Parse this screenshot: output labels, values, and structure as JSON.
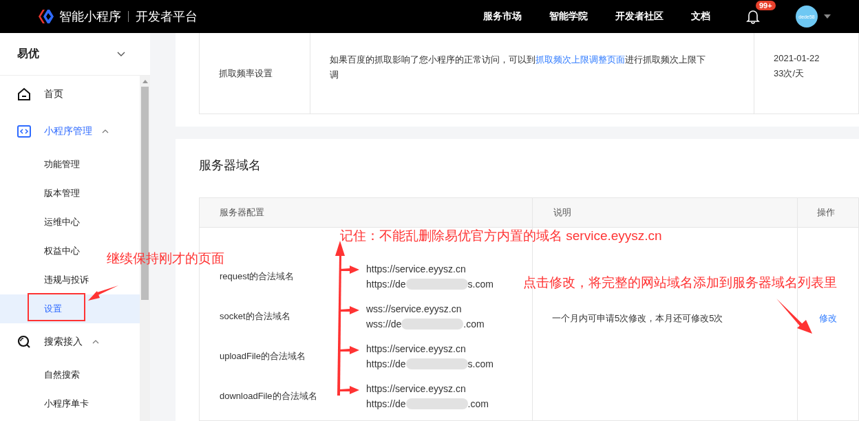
{
  "topbar": {
    "brand": "智能小程序",
    "subtitle": "开发者平台",
    "nav": [
      "服务市场",
      "智能学院",
      "开发者社区",
      "文档"
    ],
    "badge": "99+",
    "avatar": "dede58"
  },
  "sidebar": {
    "app": "易优",
    "items": [
      {
        "label": "首页",
        "active": false
      },
      {
        "label": "小程序管理",
        "active": true,
        "expanded": true,
        "children": [
          {
            "label": "功能管理",
            "selected": false
          },
          {
            "label": "版本管理",
            "selected": false
          },
          {
            "label": "运维中心",
            "selected": false
          },
          {
            "label": "权益中心",
            "selected": false
          },
          {
            "label": "违规与投诉",
            "selected": false
          },
          {
            "label": "设置",
            "selected": true
          }
        ]
      },
      {
        "label": "搜索接入",
        "active": false,
        "expanded": true,
        "children": [
          {
            "label": "自然搜索",
            "selected": false
          },
          {
            "label": "小程序单卡",
            "selected": false
          }
        ]
      }
    ]
  },
  "crawl_row": {
    "name": "抓取频率设置",
    "description": "如果百度的抓取影响了您小程序的正常访问，可以到",
    "link": "抓取频次上限调整页面",
    "description_end": "进行抓取频次上限下调",
    "date": "2021-01-22",
    "rate": "33次/天"
  },
  "server_domains": {
    "title": "服务器域名",
    "columns": [
      "服务器配置",
      "说明",
      "操作"
    ],
    "rows": [
      {
        "type": "request的合法域名",
        "domains": [
          {
            "text": "https://service.eyysz.cn"
          },
          {
            "text": "https://de",
            "suffix": "s.com"
          }
        ]
      },
      {
        "type": "socket的合法域名",
        "domains": [
          {
            "text": "wss://service.eyysz.cn"
          },
          {
            "text": "wss://de",
            "suffix": ".com"
          }
        ]
      },
      {
        "type": "uploadFile的合法域名",
        "domains": [
          {
            "text": "https://service.eyysz.cn"
          },
          {
            "text": "https://de",
            "suffix": "s.com"
          }
        ]
      },
      {
        "type": "downloadFile的合法域名",
        "domains": [
          {
            "text": "https://service.eyysz.cn"
          },
          {
            "text": "https://de",
            "suffix": ".com"
          }
        ]
      }
    ],
    "note": "一个月内可申请5次修改，本月还可修改5次",
    "action": "修改"
  },
  "annotations": [
    "继续保持刚才的页面",
    "记住：不能乱删除易优官方内置的域名 service.eyysz.cn",
    "点击修改，将完整的网站域名添加到服务器域名列表里"
  ]
}
